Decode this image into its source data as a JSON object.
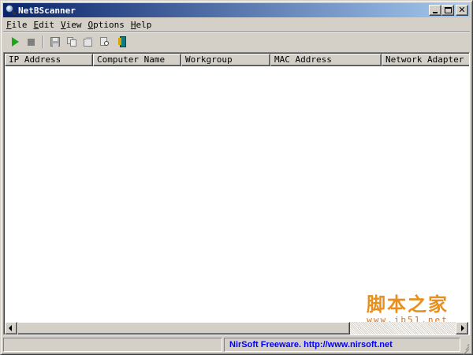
{
  "window": {
    "title": "NetBScanner"
  },
  "menu": [
    {
      "label": "File",
      "accel": "F",
      "rest": "ile"
    },
    {
      "label": "Edit",
      "accel": "E",
      "rest": "dit"
    },
    {
      "label": "View",
      "accel": "V",
      "rest": "iew"
    },
    {
      "label": "Options",
      "accel": "O",
      "rest": "ptions"
    },
    {
      "label": "Help",
      "accel": "H",
      "rest": "elp"
    }
  ],
  "toolbar": {
    "icons": [
      "play-icon",
      "stop-icon",
      "save-icon",
      "copy-icon",
      "properties-icon",
      "find-icon",
      "exit-icon"
    ]
  },
  "table": {
    "columns": [
      "IP Address",
      "Computer Name",
      "Workgroup",
      "MAC Address",
      "Network Adapter Com"
    ],
    "rows": []
  },
  "watermark": {
    "chinese": "脚本之家",
    "url": "www.jb51.net"
  },
  "statusbar": {
    "left": "",
    "right": "NirSoft Freeware.  http://www.nirsoft.net"
  },
  "colors": {
    "title_start": "#0a246a",
    "title_end": "#a6caf0",
    "link": "#0000ff",
    "play_green": "#1aa51a"
  }
}
